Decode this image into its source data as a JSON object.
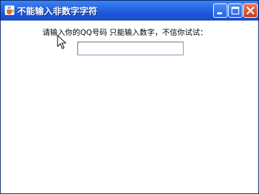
{
  "window": {
    "title": "不能输入非数字字符",
    "icon": "java-coffee-cup-icon"
  },
  "titlebar_buttons": {
    "minimize_icon": "minimize-icon",
    "maximize_icon": "maximize-icon",
    "close_icon": "close-icon"
  },
  "form": {
    "prompt_text": "请输入你的QQ号码 只能输入数字，不信你试试：",
    "qq_input_value": ""
  },
  "colors": {
    "titlebar": "#2a6ae6",
    "close_button": "#c23c1d",
    "input_border": "#7f9db9"
  }
}
